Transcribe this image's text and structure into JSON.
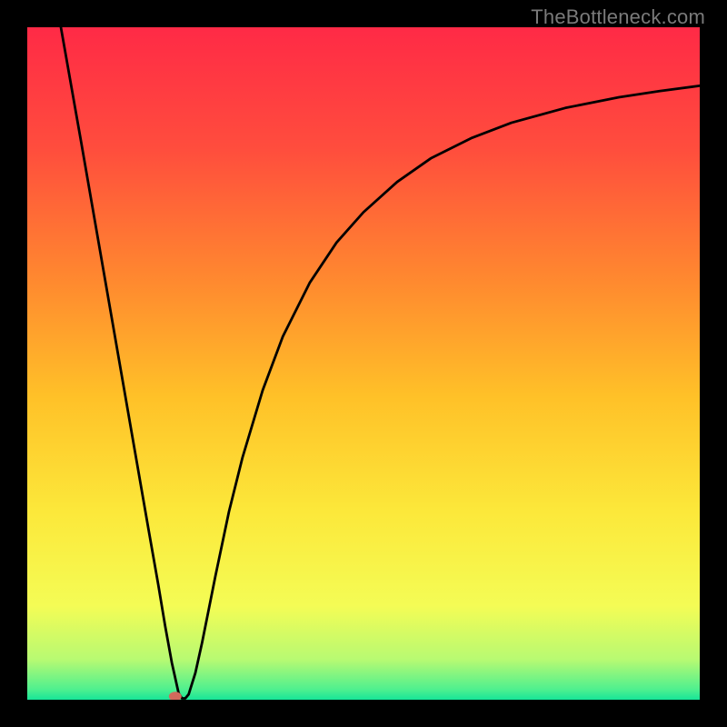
{
  "watermark": "TheBottleneck.com",
  "chart_data": {
    "type": "line",
    "title": "",
    "xlabel": "",
    "ylabel": "",
    "xlim": [
      0,
      100
    ],
    "ylim": [
      0,
      100
    ],
    "grid": false,
    "legend": false,
    "background_gradient": {
      "stops": [
        {
          "offset": 0.0,
          "color": "#ff2a46"
        },
        {
          "offset": 0.18,
          "color": "#ff4d3d"
        },
        {
          "offset": 0.38,
          "color": "#ff8a2f"
        },
        {
          "offset": 0.55,
          "color": "#ffc128"
        },
        {
          "offset": 0.72,
          "color": "#fce83a"
        },
        {
          "offset": 0.86,
          "color": "#f4fc55"
        },
        {
          "offset": 0.94,
          "color": "#b8fa72"
        },
        {
          "offset": 0.985,
          "color": "#4ef08f"
        },
        {
          "offset": 1.0,
          "color": "#17e598"
        }
      ]
    },
    "marker": {
      "x": 22.0,
      "y": 0.5,
      "color": "#d26a5c"
    },
    "series": [
      {
        "name": "curve",
        "color": "#000000",
        "x": [
          5,
          8,
          10,
          12,
          14,
          16,
          18,
          19.5,
          20.5,
          21.5,
          22.5,
          23,
          23.5,
          24,
          25,
          26,
          27,
          28,
          30,
          32,
          35,
          38,
          42,
          46,
          50,
          55,
          60,
          66,
          72,
          80,
          88,
          94,
          100
        ],
        "y": [
          100,
          83,
          71.5,
          60,
          48.5,
          37,
          25.5,
          17,
          11,
          5.5,
          1.0,
          0.2,
          0.2,
          0.8,
          4.0,
          8.5,
          13.5,
          18.5,
          28,
          36,
          46,
          54,
          62,
          68,
          72.5,
          77,
          80.5,
          83.5,
          85.8,
          88,
          89.6,
          90.5,
          91.3
        ]
      }
    ]
  }
}
